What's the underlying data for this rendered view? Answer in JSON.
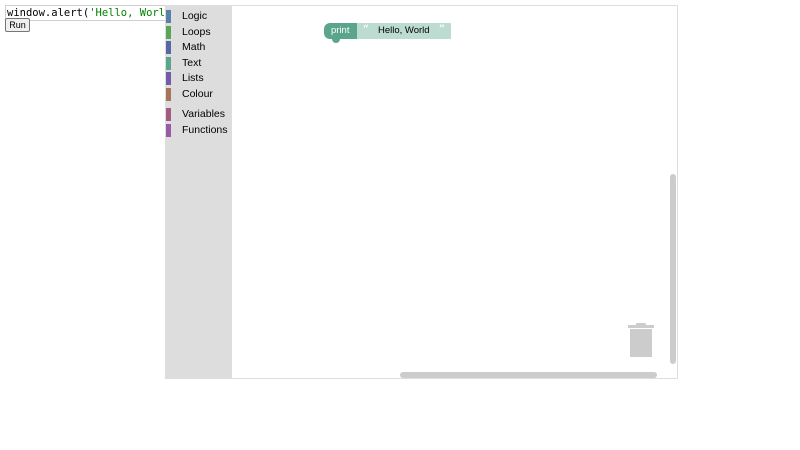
{
  "code": {
    "prefix": "window.alert(",
    "string": "'Hello, World'",
    "suffix": ");"
  },
  "run_button": {
    "label": "Run"
  },
  "toolbox": {
    "categories": [
      {
        "label": "Logic",
        "color": "#5b80a5"
      },
      {
        "label": "Loops",
        "color": "#5ba55b"
      },
      {
        "label": "Math",
        "color": "#5b67a5"
      },
      {
        "label": "Text",
        "color": "#5ba58c"
      },
      {
        "label": "Lists",
        "color": "#745ba5"
      },
      {
        "label": "Colour",
        "color": "#a5745b"
      },
      {
        "label": "Variables",
        "color": "#a55b80"
      },
      {
        "label": "Functions",
        "color": "#995ba5"
      }
    ]
  },
  "blocks": {
    "print": {
      "label": "print",
      "color": "#5ba58c"
    },
    "text": {
      "open_quote": "“",
      "value": "Hello, World",
      "close_quote": "”",
      "color": "#bcdcd1"
    }
  }
}
